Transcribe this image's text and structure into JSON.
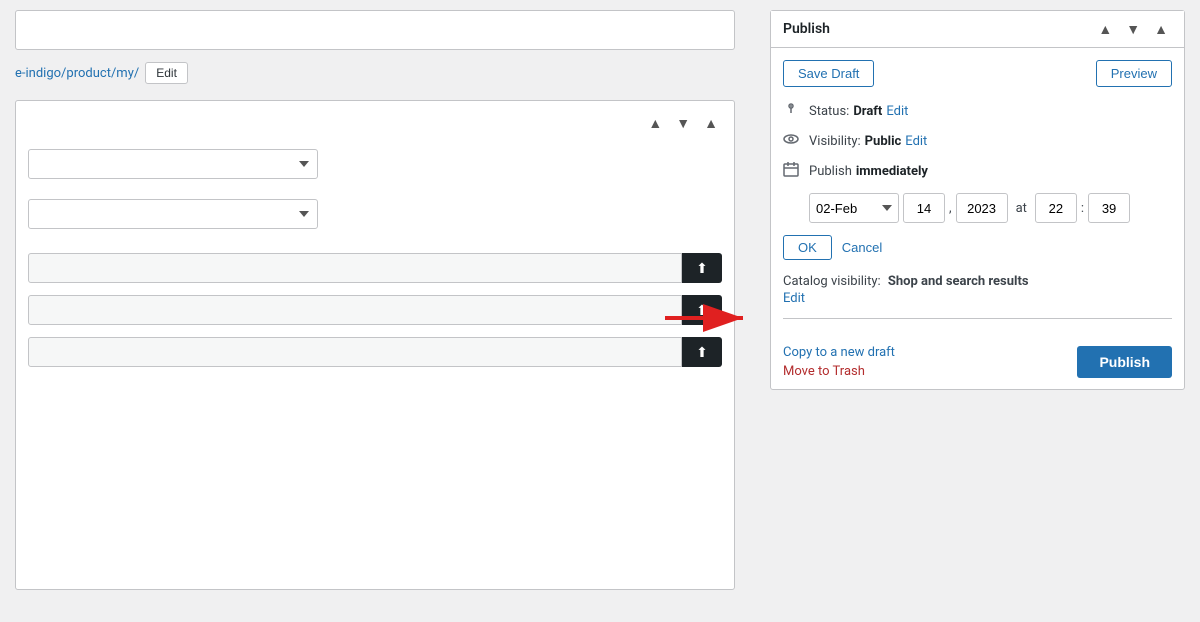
{
  "left": {
    "url_text": "e-indigo/product/my/",
    "edit_label": "Edit",
    "header_arrows": [
      "▲",
      "▼",
      "▲"
    ],
    "upload_icon": "⬆"
  },
  "publish_panel": {
    "title": "Publish",
    "header_arrows": [
      "▲",
      "▼",
      "▲"
    ],
    "save_draft_label": "Save Draft",
    "preview_label": "Preview",
    "status_label": "Status:",
    "status_value": "Draft",
    "status_edit": "Edit",
    "visibility_label": "Visibility:",
    "visibility_value": "Public",
    "visibility_edit": "Edit",
    "publish_label": "Publish",
    "publish_timing": "immediately",
    "date_month": "02-Feb",
    "date_day": "14",
    "date_year": "2023",
    "at_label": "at",
    "time_hour": "22",
    "time_min": "39",
    "ok_label": "OK",
    "cancel_label": "Cancel",
    "catalog_label": "Catalog visibility:",
    "catalog_value": "Shop and search results",
    "catalog_edit": "Edit",
    "copy_draft_label": "Copy to a new draft",
    "move_trash_label": "Move to Trash",
    "publish_btn_label": "Publish"
  }
}
